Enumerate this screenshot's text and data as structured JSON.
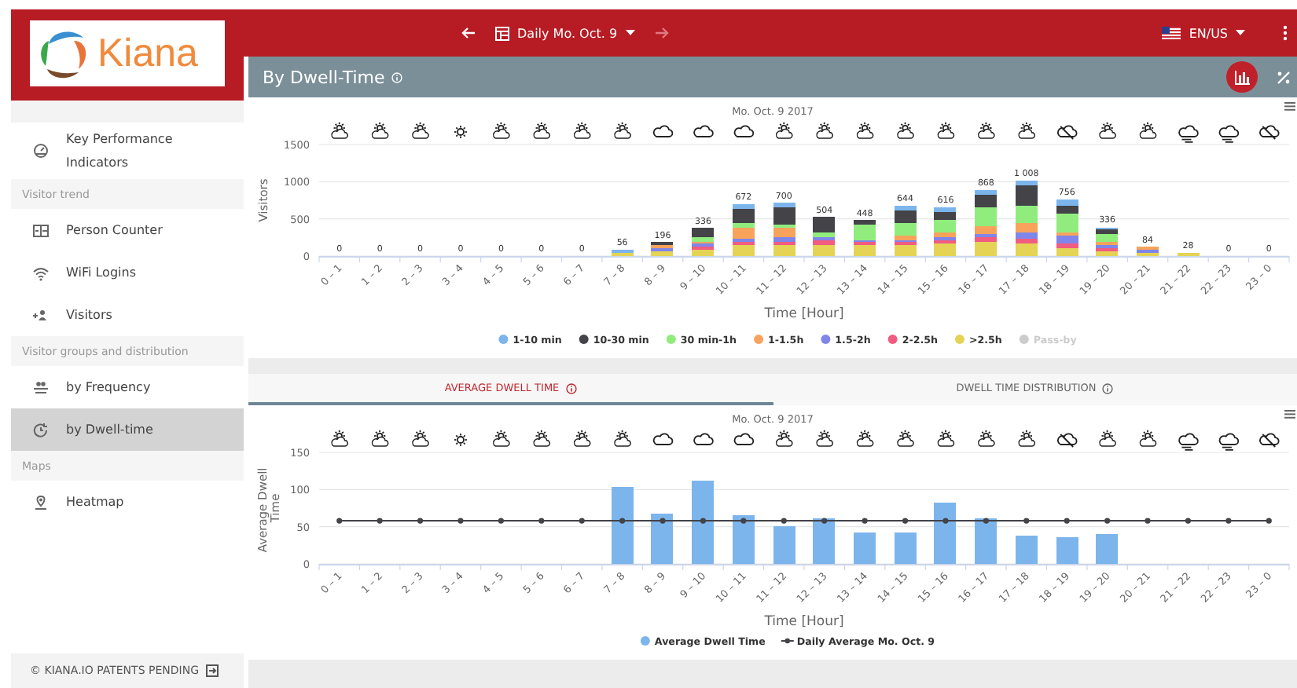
{
  "logo": {
    "text": "Kiana"
  },
  "topbar": {
    "date_selector": "Daily Mo. Oct. 9",
    "forward_disabled": true,
    "language": "EN/US"
  },
  "sidebar": {
    "sections": [
      {
        "items": [
          {
            "label": "Key Performance Indicators",
            "kind": "gauge",
            "selected": false
          }
        ]
      },
      {
        "header": "Visitor trend",
        "items": [
          {
            "label": "Person Counter",
            "kind": "counter",
            "selected": false
          },
          {
            "label": "WiFi Logins",
            "kind": "wifi",
            "selected": false
          },
          {
            "label": "Visitors",
            "kind": "visitors",
            "selected": false
          }
        ]
      },
      {
        "header": "Visitor groups and distribution",
        "items": [
          {
            "label": "by Frequency",
            "kind": "group",
            "selected": false
          },
          {
            "label": "by Dwell-time",
            "kind": "dwell",
            "selected": true
          }
        ]
      },
      {
        "header": "Maps",
        "items": [
          {
            "label": "Heatmap",
            "kind": "pin",
            "selected": false
          }
        ]
      }
    ]
  },
  "footer": {
    "text": "© KIANA.IO PATENTS PENDING"
  },
  "panel": {
    "title": "By Dwell-Time",
    "weather": [
      {
        "kind": "sun-cloud"
      },
      {
        "kind": "sun-cloud"
      },
      {
        "kind": "sun-cloud"
      },
      {
        "kind": "sun"
      },
      {
        "kind": "sun-cloud"
      },
      {
        "kind": "sun-cloud"
      },
      {
        "kind": "sun-cloud"
      },
      {
        "kind": "sun-cloud"
      },
      {
        "kind": "cloud"
      },
      {
        "kind": "cloud"
      },
      {
        "kind": "cloud"
      },
      {
        "kind": "sun-cloud"
      },
      {
        "kind": "sun-cloud"
      },
      {
        "kind": "sun-cloud"
      },
      {
        "kind": "sun-cloud"
      },
      {
        "kind": "sun-cloud"
      },
      {
        "kind": "sun-cloud"
      },
      {
        "kind": "sun-cloud"
      },
      {
        "kind": "cloud-slash"
      },
      {
        "kind": "sun-cloud"
      },
      {
        "kind": "sun-cloud"
      },
      {
        "kind": "cloud-wind"
      },
      {
        "kind": "cloud-wind"
      },
      {
        "kind": "cloud-slash"
      }
    ],
    "chart_data": {
      "type": "bar",
      "title": "Mo. Oct. 9 2017",
      "xlabel": "Time [Hour]",
      "ylabel": "Visitors",
      "stacked": true,
      "legend": "bottom",
      "categories": [
        "0 – 1",
        "1 – 2",
        "2 – 3",
        "3 – 4",
        "4 – 5",
        "5 – 6",
        "6 – 7",
        "7 – 8",
        "8 – 9",
        "9 – 10",
        "10 – 11",
        "11 – 12",
        "12 – 13",
        "13 – 14",
        "14 – 15",
        "15 – 16",
        "16 – 17",
        "17 – 18",
        "18 – 19",
        "19 – 20",
        "20 – 21",
        "21 – 22",
        "22 – 23",
        "23 – 0"
      ],
      "ylim": [
        0,
        1500
      ],
      "yticks": [
        0,
        500,
        1000,
        1500
      ],
      "value_labels": [
        "0",
        "0",
        "0",
        "0",
        "0",
        "0",
        "0",
        "56",
        "196",
        "336",
        "672",
        "700",
        "504",
        "448",
        "644",
        "616",
        "868",
        "1 008",
        "756",
        "336",
        "84",
        "28",
        "0",
        "0"
      ],
      "series": [
        {
          "name": "1-10 min",
          "color": "#7cb5ec",
          "values": [
            0,
            0,
            0,
            0,
            0,
            0,
            0,
            40,
            0,
            0,
            60,
            60,
            0,
            0,
            60,
            60,
            60,
            60,
            80,
            40,
            0,
            0,
            0,
            0
          ]
        },
        {
          "name": "10-30 min",
          "color": "#434348",
          "values": [
            0,
            0,
            0,
            0,
            0,
            0,
            0,
            0,
            40,
            110,
            200,
            220,
            200,
            60,
            170,
            110,
            170,
            280,
            110,
            60,
            0,
            0,
            0,
            0
          ]
        },
        {
          "name": "30 min-1h",
          "color": "#90ed7d",
          "values": [
            0,
            0,
            0,
            0,
            0,
            0,
            0,
            0,
            0,
            60,
            60,
            60,
            60,
            200,
            170,
            170,
            250,
            220,
            250,
            110,
            0,
            0,
            0,
            0
          ]
        },
        {
          "name": "1-1.5h",
          "color": "#f7a35c",
          "values": [
            0,
            0,
            0,
            0,
            0,
            0,
            0,
            0,
            40,
            40,
            140,
            110,
            0,
            0,
            60,
            60,
            110,
            140,
            40,
            40,
            40,
            0,
            0,
            0
          ]
        },
        {
          "name": "1.5-2h",
          "color": "#8085e9",
          "values": [
            0,
            0,
            0,
            0,
            0,
            0,
            0,
            0,
            40,
            40,
            60,
            60,
            40,
            40,
            40,
            40,
            40,
            80,
            110,
            40,
            40,
            0,
            0,
            0
          ]
        },
        {
          "name": "2-2.5h",
          "color": "#f15c80",
          "values": [
            0,
            0,
            0,
            0,
            0,
            0,
            0,
            0,
            0,
            40,
            40,
            60,
            80,
            40,
            40,
            40,
            60,
            60,
            60,
            40,
            0,
            0,
            0,
            0
          ]
        },
        {
          "name": ">2.5h",
          "color": "#e4d354",
          "values": [
            0,
            0,
            0,
            0,
            0,
            0,
            0,
            40,
            60,
            80,
            140,
            140,
            140,
            140,
            140,
            170,
            200,
            170,
            110,
            60,
            40,
            40,
            0,
            0
          ]
        },
        {
          "name": "Pass-by",
          "values": [
            null,
            null,
            null,
            null,
            null,
            null,
            null,
            null,
            null,
            null,
            null,
            null,
            null,
            null,
            null,
            null,
            null,
            null,
            null,
            null,
            null,
            null,
            null,
            null
          ]
        }
      ]
    }
  },
  "tabs": [
    {
      "label": "AVERAGE DWELL TIME",
      "selected": true
    },
    {
      "label": "DWELL TIME DISTRIBUTION",
      "selected": false
    }
  ],
  "dwell_chart": {
    "weather": [
      {
        "kind": "sun-cloud"
      },
      {
        "kind": "sun-cloud"
      },
      {
        "kind": "sun-cloud"
      },
      {
        "kind": "sun"
      },
      {
        "kind": "sun-cloud"
      },
      {
        "kind": "sun-cloud"
      },
      {
        "kind": "sun-cloud"
      },
      {
        "kind": "sun-cloud"
      },
      {
        "kind": "cloud"
      },
      {
        "kind": "cloud"
      },
      {
        "kind": "cloud"
      },
      {
        "kind": "sun-cloud"
      },
      {
        "kind": "sun-cloud"
      },
      {
        "kind": "sun-cloud"
      },
      {
        "kind": "sun-cloud"
      },
      {
        "kind": "sun-cloud"
      },
      {
        "kind": "sun-cloud"
      },
      {
        "kind": "sun-cloud"
      },
      {
        "kind": "cloud-slash"
      },
      {
        "kind": "sun-cloud"
      },
      {
        "kind": "sun-cloud"
      },
      {
        "kind": "cloud-wind"
      },
      {
        "kind": "cloud-wind"
      },
      {
        "kind": "cloud-slash"
      }
    ],
    "chart_data": {
      "type": "bar",
      "title": "Mo. Oct. 9 2017",
      "xlabel": "Time [Hour]",
      "ylabel": "Average Dwell Time",
      "stacked": false,
      "legend": "bottom",
      "categories": [
        "0 – 1",
        "1 – 2",
        "2 – 3",
        "3 – 4",
        "4 – 5",
        "5 – 6",
        "6 – 7",
        "7 – 8",
        "8 – 9",
        "9 – 10",
        "10 – 11",
        "11 – 12",
        "12 – 13",
        "13 – 14",
        "14 – 15",
        "15 – 16",
        "16 – 17",
        "17 – 18",
        "18 – 19",
        "19 – 20",
        "20 – 21",
        "21 – 22",
        "22 – 23",
        "23 – 0"
      ],
      "ylim": [
        0,
        150
      ],
      "yticks": [
        0,
        50,
        100,
        150
      ],
      "series": [
        {
          "name": "Average Dwell Time",
          "color": "#7cb5ec",
          "values": [
            null,
            null,
            null,
            null,
            null,
            null,
            null,
            103,
            68,
            113,
            65,
            50,
            61,
            43,
            43,
            83,
            61,
            39,
            35,
            41,
            null,
            null,
            null,
            null
          ]
        },
        {
          "name": "Daily Average Mo. Oct. 9",
          "type": "line",
          "marker": true,
          "color": "#434348",
          "values": [
            58,
            58,
            58,
            58,
            58,
            58,
            58,
            58,
            58,
            58,
            58,
            58,
            58,
            58,
            58,
            58,
            58,
            58,
            58,
            58,
            58,
            58,
            58,
            58
          ]
        }
      ]
    }
  }
}
